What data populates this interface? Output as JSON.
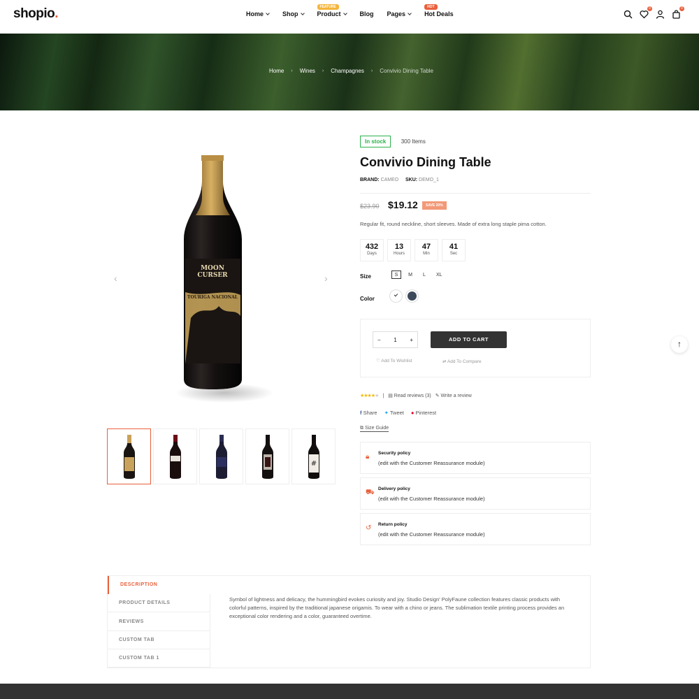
{
  "header": {
    "logo": "shopio",
    "nav": [
      {
        "label": "Home",
        "dropdown": true
      },
      {
        "label": "Shop",
        "dropdown": true
      },
      {
        "label": "Product",
        "dropdown": true,
        "badge": "FEATURE",
        "badge_color": "#f5b53b"
      },
      {
        "label": "Blog",
        "dropdown": false
      },
      {
        "label": "Pages",
        "dropdown": true
      },
      {
        "label": "Hot Deals",
        "dropdown": false,
        "badge": "HOT",
        "badge_color": "#e8603c"
      }
    ],
    "icons": [
      "search-icon",
      "heart-icon",
      "user-icon",
      "cart-icon"
    ],
    "wishlist_count": "0",
    "cart_count": "0"
  },
  "breadcrumb": [
    "Home",
    "Wines",
    "Champagnes",
    "Convivio Dining Table"
  ],
  "product": {
    "stock": "In stock",
    "items": "300 Items",
    "title": "Convivio Dining Table",
    "brand_label": "BRAND:",
    "brand": "CAMEO",
    "sku_label": "SKU:",
    "sku": "DEMO_1",
    "old_price": "$23.90",
    "price": "$19.12",
    "save": "SAVE 20%",
    "description": "Regular fit, round neckline, short sleeves. Made of extra long staple pima cotton.",
    "countdown": [
      {
        "num": "432",
        "label": "Days"
      },
      {
        "num": "13",
        "label": "Hours"
      },
      {
        "num": "47",
        "label": "Min"
      },
      {
        "num": "41",
        "label": "Sec"
      }
    ],
    "size_label": "Size",
    "sizes": [
      "S",
      "M",
      "L",
      "XL"
    ],
    "selected_size": "S",
    "color_label": "Color",
    "colors": [
      "#ffffff",
      "#3d4a5c"
    ],
    "qty": "1",
    "add_to_cart": "ADD TO CART",
    "wishlist": "Add To Wishlist",
    "compare": "Add To Compare",
    "rating": 4,
    "read_reviews": "Read reviews (3)",
    "write_review": "Write a review",
    "share": [
      "Share",
      "Tweet",
      "Pinterest"
    ],
    "size_guide": "Size Guide"
  },
  "policies": [
    {
      "title": "Security policy",
      "sub": "(edit with the Customer Reassurance module)",
      "icon": "lock-icon"
    },
    {
      "title": "Delivery policy",
      "sub": "(edit with the Customer Reassurance module)",
      "icon": "truck-icon"
    },
    {
      "title": "Return policy",
      "sub": "(edit with the Customer Reassurance module)",
      "icon": "return-icon"
    }
  ],
  "tabs": [
    "DESCRIPTION",
    "PRODUCT DETAILS",
    "REVIEWS",
    "CUSTOM TAB",
    "CUSTOM TAB 1"
  ],
  "tab_content": "Symbol of lightness and delicacy, the hummingbird evokes curiosity and joy. Studio Design' PolyFaune collection features classic products with colorful patterns, inspired by the traditional japanese origamis. To wear with a chino or jeans. The sublimation textile printing process provides an exceptional color rendering and a color, guaranteed overtime.",
  "accent": "#e8603c"
}
